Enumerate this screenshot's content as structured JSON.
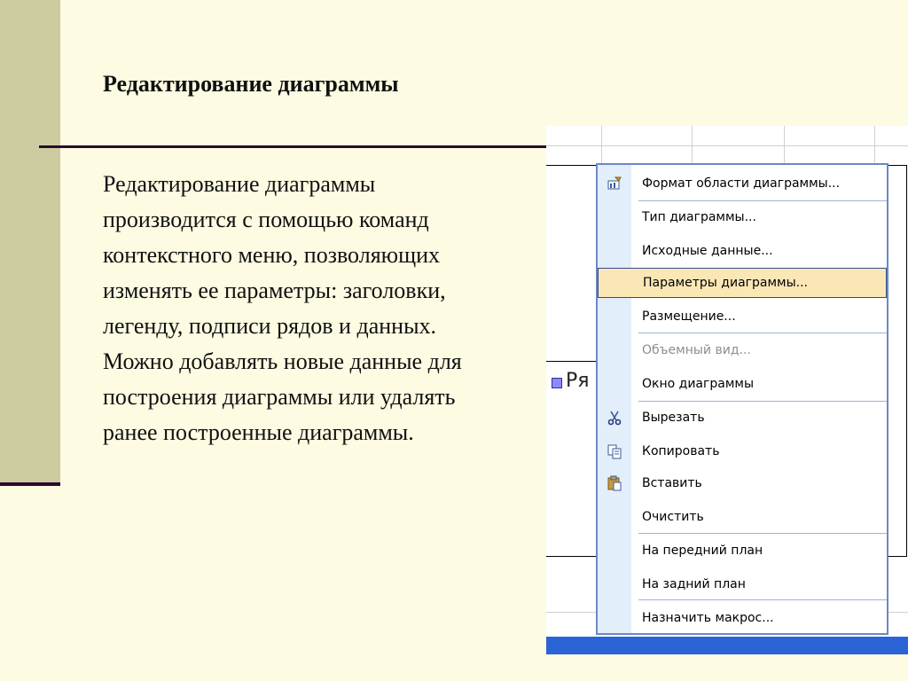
{
  "slide": {
    "title": "Редактирование диаграммы",
    "body_lines": [
      "Редактирование диаграммы",
      "производится с помощью команд",
      "контекстного меню, позволяющих",
      "изменять ее параметры: заголовки,",
      "легенду, подписи рядов и данных.",
      "Можно добавлять новые данные для",
      "построения диаграммы или удалять",
      "ранее построенные диаграммы."
    ]
  },
  "chart": {
    "legend_fragment": "Ря"
  },
  "context_menu": {
    "items": [
      {
        "label": "Формат области диаграммы...",
        "icon": "format-area-icon",
        "enabled": true,
        "highlighted": false
      },
      {
        "label": "Тип диаграммы...",
        "enabled": true,
        "highlighted": false
      },
      {
        "label": "Исходные данные...",
        "enabled": true,
        "highlighted": false
      },
      {
        "label": "Параметры диаграммы...",
        "enabled": true,
        "highlighted": true
      },
      {
        "label": "Размещение...",
        "enabled": true,
        "highlighted": false
      },
      {
        "label": "Объемный вид...",
        "enabled": false,
        "highlighted": false
      },
      {
        "label": "Окно диаграммы",
        "enabled": true,
        "highlighted": false
      },
      {
        "label": "Вырезать",
        "icon": "scissors-icon",
        "enabled": true,
        "highlighted": false
      },
      {
        "label": "Копировать",
        "icon": "copy-icon",
        "enabled": true,
        "highlighted": false
      },
      {
        "label": "Вставить",
        "icon": "paste-icon",
        "enabled": true,
        "highlighted": false
      },
      {
        "label": "Очистить",
        "enabled": true,
        "highlighted": false
      },
      {
        "label": "На передний план",
        "enabled": true,
        "highlighted": false
      },
      {
        "label": "На задний план",
        "enabled": true,
        "highlighted": false
      },
      {
        "label": "Назначить макрос...",
        "enabled": true,
        "highlighted": false
      }
    ]
  },
  "colors": {
    "slide_background": "#fdfbe2",
    "sidebar": "#cccca0",
    "rule": "#2c0a2c",
    "menu_highlight": "#fbe7b6",
    "menu_border": "#6a89c4"
  }
}
